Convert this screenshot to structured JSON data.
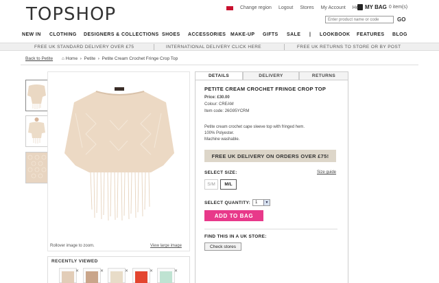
{
  "header": {
    "logo": "TOPSHOP",
    "links": [
      "Change region",
      "Logout",
      "Stores",
      "My Account",
      "Help"
    ],
    "bag_label": "MY BAG",
    "bag_count": "0 item(s)",
    "search_placeholder": "Enter product name or code",
    "go_label": "GO"
  },
  "nav": [
    "NEW IN",
    "CLOTHING",
    "DESIGNERS & COLLECTIONS",
    "SHOES",
    "ACCESSORIES",
    "MAKE-UP",
    "GIFTS",
    "SALE",
    "|",
    "LOOKBOOK",
    "FEATURES",
    "BLOG"
  ],
  "promos": [
    "FREE UK STANDARD DELIVERY OVER £75",
    "INTERNATIONAL DELIVERY CLICK HERE",
    "FREE UK RETURNS TO STORE OR BY POST"
  ],
  "breadcrumb": {
    "back": "Back to Petite",
    "items": [
      "Home",
      "Petite",
      "Petite Cream Crochet Fringe Crop Top"
    ]
  },
  "image": {
    "zoom_hint": "Rollover image to zoom.",
    "view_large": "View large image"
  },
  "recent": {
    "title": "RECENTLY VIEWED",
    "colors": [
      "#e2cdb8",
      "#c9a58a",
      "#e8dcc8",
      "#e3452f",
      "#e04a38",
      "#bfe3d2"
    ]
  },
  "tabs": [
    "DETAILS",
    "DELIVERY",
    "RETURNS"
  ],
  "product": {
    "title": "PETITE CREAM CROCHET FRINGE CROP TOP",
    "price_label": "Price:",
    "price": "£30.00",
    "colour_label": "Colour:",
    "colour": "CREAM",
    "code_label": "Item code:",
    "code": "26G95YCRM",
    "desc": [
      "Petite cream crochet cape sleeve top with fringed hem.",
      "100% Polyester.",
      "Machine washable."
    ],
    "delivery_banner": "FREE UK DELIVERY ON ORDERS OVER £75!",
    "size_label": "SELECT SIZE:",
    "size_guide": "Size guide",
    "sizes": [
      "S/M",
      "M/L"
    ],
    "qty_label": "SELECT QUANTITY:",
    "qty_value": "1",
    "add_to_bag": "ADD TO BAG",
    "store_label": "FIND THIS IN A UK STORE:",
    "check_stores": "Check stores"
  },
  "colors": {
    "accent": "#e8398a",
    "banner": "#ddd6c9",
    "garment": "#ead8c3"
  }
}
